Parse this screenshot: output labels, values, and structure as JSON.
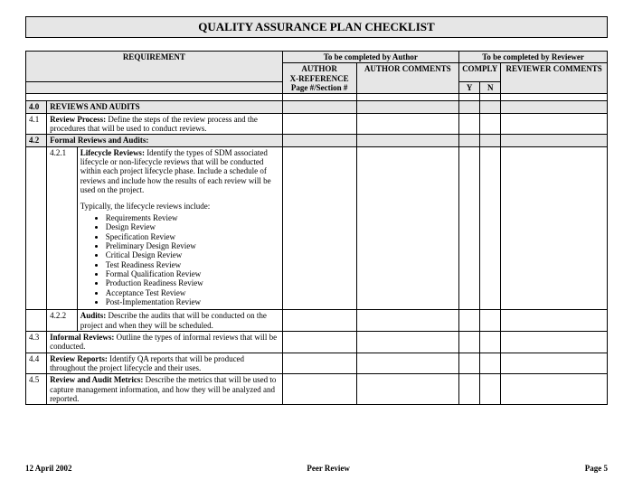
{
  "title": "QUALITY ASSURANCE PLAN CHECKLIST",
  "headers": {
    "requirement": "REQUIREMENT",
    "authorGroup": "To be completed by Author",
    "reviewerGroup": "To be completed by Reviewer",
    "authorRef1": "AUTHOR",
    "authorRef2": "X-REFERENCE",
    "authorRef3": "Page #/Section #",
    "authorComments": "AUTHOR COMMENTS",
    "comply": "COMPLY",
    "y": "Y",
    "n": "N",
    "reviewerComments": "REVIEWER COMMENTS"
  },
  "section": {
    "num": "4.0",
    "title": "REVIEWS AND AUDITS"
  },
  "r41": {
    "num": "4.1",
    "label": "Review Process:",
    "text": "  Define the steps of the review process and the procedures that will be used to conduct reviews."
  },
  "r42": {
    "num": "4.2",
    "label": "Formal Reviews and Audits:"
  },
  "r421": {
    "num": "4.2.1",
    "label": "Lifecycle Reviews:",
    "text1": "  Identify the types of SDM associated lifecycle or non-lifecycle reviews that will be conducted within each project lifecycle phase.  Include a schedule of reviews and include how the results of each review will be used on the project.",
    "text2": "Typically, the lifecycle reviews include:",
    "bullets": [
      "Requirements Review",
      "Design Review",
      "Specification Review",
      "Preliminary Design Review",
      "Critical Design Review",
      "Test Readiness Review",
      "Formal Qualification Review",
      "Production Readiness Review",
      "Acceptance Test Review",
      "Post-Implementation Review"
    ]
  },
  "r422": {
    "num": "4.2.2",
    "label": "Audits:",
    "text": "  Describe the audits that will be conducted on the project and when they will be scheduled."
  },
  "r43": {
    "num": "4.3",
    "label": "Informal Reviews:",
    "text": "  Outline the types of informal reviews that will be conducted."
  },
  "r44": {
    "num": "4.4",
    "label": "Review Reports:",
    "text": "  Identify QA reports that will be produced throughout the project lifecycle and their uses."
  },
  "r45": {
    "num": "4.5",
    "label": "Review and Audit Metrics:",
    "text": "  Describe the metrics that will be used to capture management information, and how they will be analyzed and reported."
  },
  "footer": {
    "date": "12 April 2002",
    "center": "Peer Review",
    "page": "Page 5"
  }
}
